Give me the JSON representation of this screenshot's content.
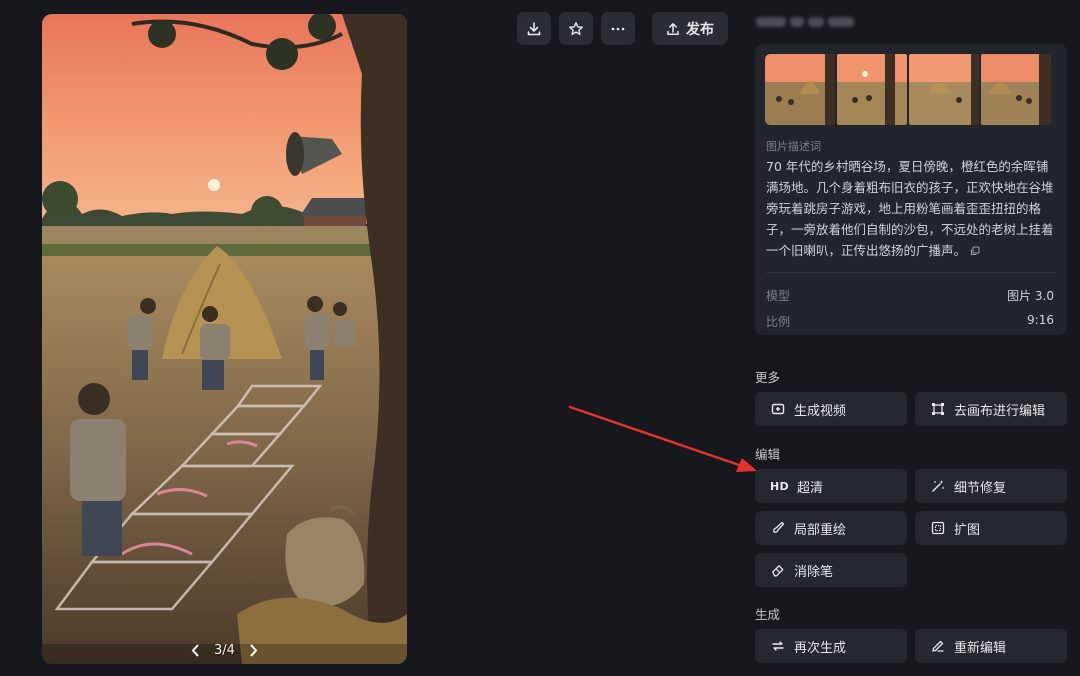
{
  "image_viewer": {
    "pager_text": "3/4"
  },
  "toolbar": {
    "download_icon": "download-icon",
    "favorite_icon": "star-icon",
    "more_icon": "more-icon",
    "publish_label": "发布"
  },
  "info": {
    "description_label": "图片描述词",
    "description": "70 年代的乡村晒谷场，夏日傍晚，橙红色的余晖铺满场地。几个身着粗布旧衣的孩子，正欢快地在谷堆旁玩着跳房子游戏，地上用粉笔画着歪歪扭扭的格子，一旁放着他们自制的沙包，不远处的老树上挂着一个旧喇叭，正传出悠扬的广播声。",
    "model_label": "模型",
    "model_value": "图片 3.0",
    "ratio_label": "比例",
    "ratio_value": "9:16"
  },
  "sections": {
    "more": {
      "label": "更多",
      "buttons": [
        "生成视频",
        "去画布进行编辑"
      ]
    },
    "edit": {
      "label": "编辑",
      "hd_prefix": "HD",
      "buttons": [
        "超清",
        "细节修复",
        "局部重绘",
        "扩图",
        "消除笔"
      ]
    },
    "generate": {
      "label": "生成",
      "buttons": [
        "再次生成",
        "重新编辑"
      ]
    }
  },
  "colors": {
    "page_bg": "#16181d",
    "card_bg": "#22252b",
    "button_bg": "#25282e",
    "annotation_arrow": "#e5322d"
  }
}
